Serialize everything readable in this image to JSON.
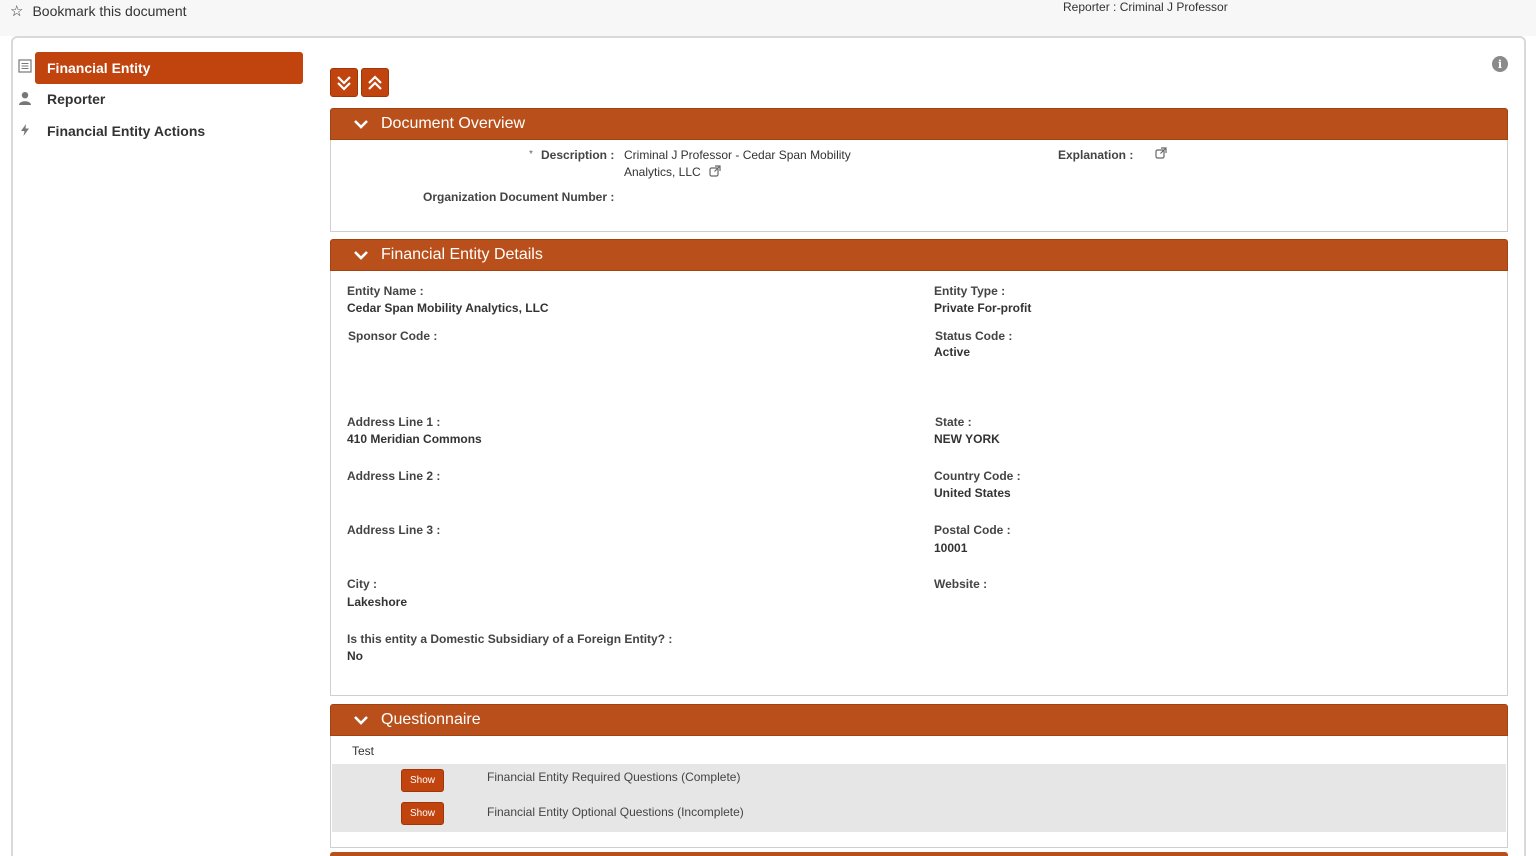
{
  "topbar": {
    "bookmark_label": "Bookmark this document",
    "reporter_label": "Reporter :",
    "reporter_name": "Criminal J Professor"
  },
  "sidebar": {
    "items": [
      {
        "label": "Financial Entity",
        "icon": "document-list-icon",
        "active": true
      },
      {
        "label": "Reporter",
        "icon": "person-icon",
        "active": false
      },
      {
        "label": "Financial Entity Actions",
        "icon": "lightning-icon",
        "active": false
      }
    ]
  },
  "controls": {
    "expand_all_icon": "double-chevron-down-icon",
    "collapse_all_icon": "double-chevron-up-icon",
    "info_icon": "info-icon"
  },
  "document_overview": {
    "title": "Document Overview",
    "required_marker": "*",
    "description_label": "Description :",
    "description_line1": "Criminal J Professor - Cedar Span Mobility",
    "description_line2": "Analytics, LLC",
    "explanation_label": "Explanation :",
    "org_doc_number_label": "Organization Document Number :"
  },
  "financial_entity_details": {
    "title": "Financial Entity Details",
    "entity_name_label": "Entity Name :",
    "entity_name": "Cedar Span Mobility Analytics, LLC",
    "entity_type_label": "Entity Type :",
    "entity_type": "Private For-profit",
    "sponsor_code_label": "Sponsor Code :",
    "status_code_label": "Status Code :",
    "status_code": "Active",
    "address1_label": "Address Line 1 :",
    "address1": "410 Meridian Commons",
    "state_label": "State :",
    "state": "NEW YORK",
    "address2_label": "Address Line 2 :",
    "country_code_label": "Country Code :",
    "country_code": "United States",
    "address3_label": "Address Line 3 :",
    "postal_code_label": "Postal Code :",
    "postal_code": "10001",
    "city_label": "City :",
    "city": "Lakeshore",
    "website_label": "Website :",
    "subsidiary_label": "Is this entity a Domestic Subsidiary of a Foreign Entity? :",
    "subsidiary": "No"
  },
  "questionnaire": {
    "title": "Questionnaire",
    "group_name": "Test",
    "rows": [
      {
        "button_label": "Show",
        "text": "Financial Entity Required Questions (Complete)"
      },
      {
        "button_label": "Show",
        "text": "Financial Entity Optional Questions (Incomplete)"
      }
    ]
  },
  "colors": {
    "accent": "#c1440e",
    "header": "#b9501b"
  }
}
